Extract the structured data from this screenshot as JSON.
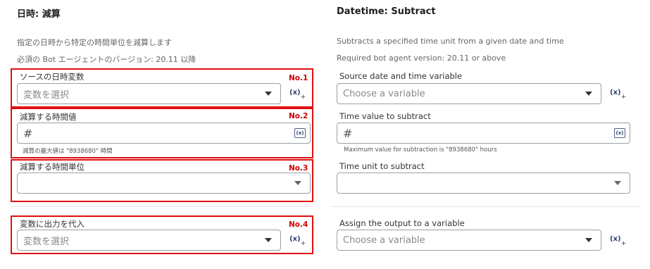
{
  "jp": {
    "title": "日時: 減算",
    "description": "指定の日時から特定の時間単位を減算します",
    "version": "必須の Bot エージェントのバージョン: 20.11 以降",
    "source_label": "ソースの日時変数",
    "source_placeholder": "変数を選択",
    "value_label": "減算する時間値",
    "value_hint": "減算の最大値は \"8938680\" 時間",
    "unit_label": "減算する時間単位",
    "output_label": "変数に出力を代入",
    "output_placeholder": "変数を選択",
    "tags": [
      "No.1",
      "No.2",
      "No.3",
      "No.4"
    ]
  },
  "en": {
    "title": "Datetime: Subtract",
    "description": "Subtracts a specified time unit from a given date and time",
    "version": "Required bot agent version: 20.11 or above",
    "source_label": "Source date and time variable",
    "source_placeholder": "Choose a variable",
    "value_label": "Time value to subtract",
    "value_hint": "Maximum value for subtraction is \"8938680\" hours",
    "unit_label": "Time unit to subtract",
    "output_label": "Assign the output to a variable",
    "output_placeholder": "Choose a variable"
  },
  "icons": {
    "hash": "#",
    "var_box": "(x)",
    "var_insert": "(x)",
    "var_plus": "+"
  },
  "colors": {
    "highlight": "#e01010",
    "tag": "#d00000",
    "icon": "#2b3f6b"
  }
}
